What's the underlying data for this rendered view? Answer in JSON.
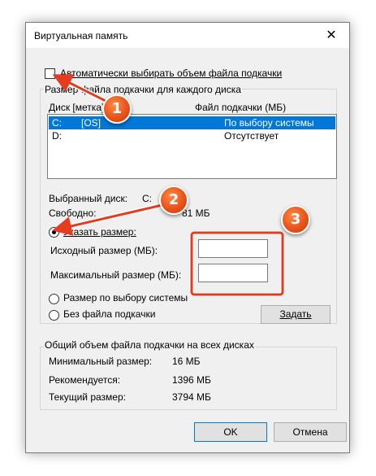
{
  "window": {
    "title": "Виртуальная память",
    "close_glyph": "✕"
  },
  "auto_checkbox": {
    "label": "Автоматически выбирать объем файла подкачки",
    "checked": false
  },
  "paging_group": {
    "legend": "Размер файла подкачки для каждого диска",
    "columns": {
      "drive": "Диск [метка]",
      "file": "Файл подкачки (МБ)"
    },
    "rows": [
      {
        "drive": "C:",
        "label": "[OS]",
        "file": "По выбору системы",
        "selected": true
      },
      {
        "drive": "D:",
        "label": "",
        "file": "Отсутствует",
        "selected": false
      }
    ],
    "selected_drive_label": "Выбранный диск:",
    "selected_drive_value": "C:",
    "free_label": "Свободно:",
    "free_value": "81 МБ",
    "custom_radio": "Указать размер:",
    "initial_label": "Исходный размер (МБ):",
    "initial_value": "",
    "max_label": "Максимальный размер (МБ):",
    "max_value": "",
    "system_radio": "Размер по выбору системы",
    "none_radio": "Без файла подкачки",
    "set_button": "Задать"
  },
  "total_group": {
    "legend": "Общий объем файла подкачки на всех дисках",
    "min_label": "Минимальный размер:",
    "min_value": "16 МБ",
    "recommended_label": "Рекомендуется:",
    "recommended_value": "1396 МБ",
    "current_label": "Текущий размер:",
    "current_value": "3794 МБ"
  },
  "buttons": {
    "ok": "OK",
    "cancel": "Отмена"
  },
  "annotations": {
    "badges": [
      "1",
      "2",
      "3"
    ],
    "color": "#e53b1e"
  }
}
